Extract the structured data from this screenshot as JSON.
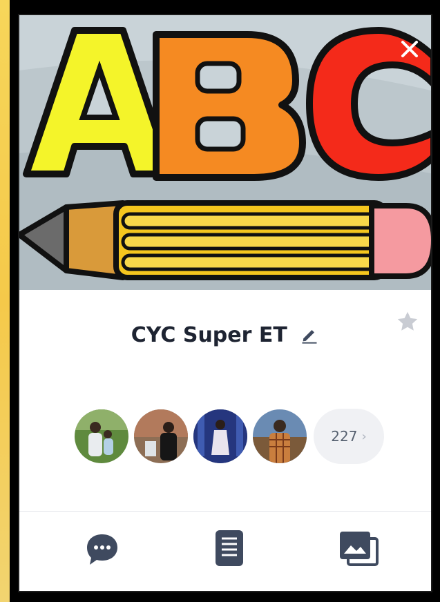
{
  "profile": {
    "name": "CYC Super ET"
  },
  "members": {
    "count": "227",
    "chevron": "›"
  },
  "colors": {
    "accent_dark": "#3f4a5f",
    "star_gray": "#c9ccd3",
    "pill_bg": "#f0f1f4",
    "frame_gold": "#f5c94a"
  },
  "icons": {
    "close": "close-icon",
    "star": "star-icon",
    "edit": "pencil-edit-icon",
    "chat": "chat-bubble-icon",
    "notes": "notes-icon",
    "album": "photo-album-icon"
  }
}
